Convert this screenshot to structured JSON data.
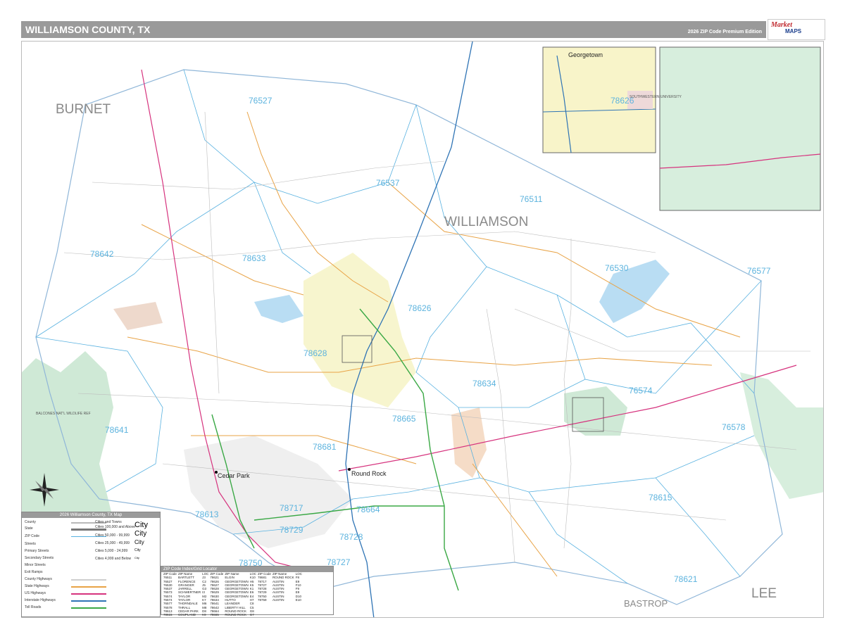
{
  "header": {
    "title": "WILLIAMSON COUNTY, TX",
    "edition": "2026 ZIP Code Premium Edition"
  },
  "logo": {
    "brand": "Market",
    "maps": "MAPS"
  },
  "regions": {
    "burnet": "BURNET",
    "williamson": "WILLIAMSON",
    "bastrop": "BASTROP",
    "lee": "LEE"
  },
  "zips": {
    "z76527": "76527",
    "z76537": "76537",
    "z76511": "76511",
    "z78642": "78642",
    "z78633": "78633",
    "z76530": "76530",
    "z76577": "76577",
    "z78626": "78626",
    "z78628": "78628",
    "z78634": "78634",
    "z76574": "76574",
    "z78641": "78641",
    "z78665": "78665",
    "z76578": "76578",
    "z78681": "78681",
    "z78613": "78613",
    "z78717": "78717",
    "z78664": "78664",
    "z78615": "78615",
    "z78729": "78729",
    "z78728": "78728",
    "z78727": "78727",
    "z78750": "78750",
    "z78621": "78621",
    "inset_zip": "78626"
  },
  "cities": {
    "cedar_park": "Cedar Park",
    "round_rock": "Round Rock",
    "georgetown_inset": "Georgetown",
    "southwestern": "SOUTHWESTERN UNIVERSITY",
    "balcones": "BALCONES NAT'L WILDLIFE REF"
  },
  "legend": {
    "title": "2026 Williamson County, TX Map",
    "items": [
      "County",
      "State",
      "ZIP Code",
      "Streets",
      "Primary Streets",
      "Secondary Streets",
      "Minor Streets",
      "Exit Ramps",
      "County Highways",
      "State Highways",
      "US Highways",
      "Interstate Highways",
      "Toll Roads"
    ],
    "cities_head": "Cities and Towns",
    "city_classes": [
      "Cities 100,000 and Above",
      "Cities 50,000 - 99,999",
      "Cities 25,000 - 49,999",
      "Cities 5,000 - 24,999",
      "Cities 4,999 and Below"
    ],
    "city_sample": "City",
    "colors": {
      "county": "#b9b9b9",
      "state": "#777777",
      "zip": "#58b1e0",
      "streets": "#c9c9c9",
      "county_hwy": "#cfcfcf",
      "state_hwy": "#e8a346",
      "us_hwy": "#d6337e",
      "interstate": "#2f74b5",
      "toll": "#3aa845"
    }
  },
  "zip_index": {
    "title": "ZIP Code Index/Grid Locator",
    "headers": [
      "ZIP Code",
      "ZIP Name",
      "LOC",
      "ZIP Code",
      "ZIP Name",
      "LOC",
      "ZIP Code",
      "ZIP Name",
      "LOC",
      "ZIP Code",
      "ZIP Name",
      "LOC"
    ],
    "rows": [
      [
        "76511",
        "BARTLETT",
        "J3",
        "78621",
        "ELGIN",
        "K10",
        "78681",
        "ROUND ROCK",
        "F8"
      ],
      [
        "76527",
        "FLORENCE",
        "C2",
        "78626",
        "GEORGETOWN",
        "H5",
        "78717",
        "AUSTIN",
        "E9"
      ],
      [
        "76530",
        "GRANGER",
        "J5",
        "78627",
        "GEORGETOWN",
        "K5",
        "78727",
        "AUSTIN",
        "F10"
      ],
      [
        "76537",
        "JARRELL",
        "G3",
        "78628",
        "GEORGETOWN",
        "K1",
        "78728",
        "AUSTIN",
        "F9"
      ],
      [
        "76573",
        "SCHWERTNER",
        "I3",
        "78629",
        "GEORGETOWN",
        "E6",
        "78729",
        "AUSTIN",
        "E9"
      ],
      [
        "76574",
        "TAYLOR",
        "M2",
        "78630",
        "GEORGETOWN",
        "E4",
        "78750",
        "AUSTIN",
        "D10"
      ],
      [
        "76574",
        "TAYLOR",
        "K7",
        "78634",
        "HUTTO",
        "H7",
        "78759",
        "AUSTIN",
        "E10"
      ],
      [
        "76577",
        "THORNDALE",
        "M6",
        "78641",
        "LEANDER",
        "C8",
        "",
        "",
        ""
      ],
      [
        "76578",
        "THRALL",
        "M8",
        "78642",
        "LIBERTY HILL",
        "C5",
        "",
        "",
        ""
      ],
      [
        "78613",
        "CEDAR PARK",
        "D8",
        "78664",
        "ROUND ROCK",
        "G8",
        "",
        "",
        ""
      ],
      [
        "78615",
        "COUPLAND",
        "K9",
        "78665",
        "ROUND ROCK",
        "G7",
        "",
        "",
        ""
      ]
    ]
  }
}
